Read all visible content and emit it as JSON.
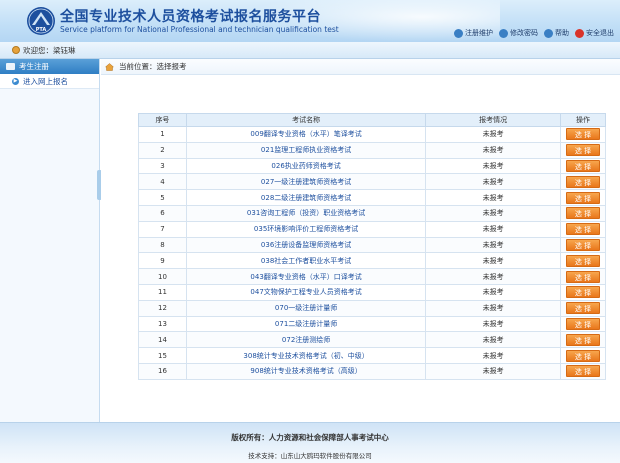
{
  "header": {
    "title_cn": "全国专业技术人员资格考试报名服务平台",
    "title_en": "Service platform for National Professional and technician qualification test",
    "logo_text": "PTA",
    "links": [
      {
        "label": "注册维护",
        "icon": "user-edit-icon",
        "color": "#3a7fc4"
      },
      {
        "label": "修改密码",
        "icon": "key-icon",
        "color": "#3a7fc4"
      },
      {
        "label": "帮助",
        "icon": "help-icon",
        "color": "#3a7fc4"
      },
      {
        "label": "安全退出",
        "icon": "power-icon",
        "color": "#d9342b"
      }
    ]
  },
  "welcome": {
    "prefix": "欢迎您：",
    "username": "梁钰琳"
  },
  "sidebar": {
    "section_title": "考生注册",
    "items": [
      {
        "label": "进入网上报名"
      }
    ]
  },
  "breadcrumb": {
    "text": "当前位置：选择报考"
  },
  "table": {
    "headers": [
      "序号",
      "考试名称",
      "报考情况",
      "操作"
    ],
    "button_label": "选 择",
    "rows": [
      {
        "no": "1",
        "name": "009翻译专业资格（水平）笔译考试",
        "status": "未报考"
      },
      {
        "no": "2",
        "name": "021监理工程师执业资格考试",
        "status": "未报考"
      },
      {
        "no": "3",
        "name": "026执业药师资格考试",
        "status": "未报考"
      },
      {
        "no": "4",
        "name": "027一级注册建筑师资格考试",
        "status": "未报考"
      },
      {
        "no": "5",
        "name": "028二级注册建筑师资格考试",
        "status": "未报考"
      },
      {
        "no": "6",
        "name": "031咨询工程师（投资）职业资格考试",
        "status": "未报考"
      },
      {
        "no": "7",
        "name": "035环境影响评价工程师资格考试",
        "status": "未报考"
      },
      {
        "no": "8",
        "name": "036注册设备监理师资格考试",
        "status": "未报考"
      },
      {
        "no": "9",
        "name": "038社会工作者职业水平考试",
        "status": "未报考"
      },
      {
        "no": "10",
        "name": "043翻译专业资格（水平）口译考试",
        "status": "未报考"
      },
      {
        "no": "11",
        "name": "047文物保护工程专业人员资格考试",
        "status": "未报考"
      },
      {
        "no": "12",
        "name": "070一级注册计量师",
        "status": "未报考"
      },
      {
        "no": "13",
        "name": "071二级注册计量师",
        "status": "未报考"
      },
      {
        "no": "14",
        "name": "072注册测绘师",
        "status": "未报考"
      },
      {
        "no": "15",
        "name": "308统计专业技术资格考试（初、中级）",
        "status": "未报考"
      },
      {
        "no": "16",
        "name": "908统计专业技术资格考试（高级）",
        "status": "未报考"
      }
    ]
  },
  "footer": {
    "copyright": "版权所有：人力资源和社会保障部人事考试中心",
    "tech_support": "技术支持：山东山大鸥玛软件股份有限公司"
  },
  "colors": {
    "accent": "#1d4f9e",
    "button": "#e9771c",
    "header_bg": "#c3e0f7"
  }
}
